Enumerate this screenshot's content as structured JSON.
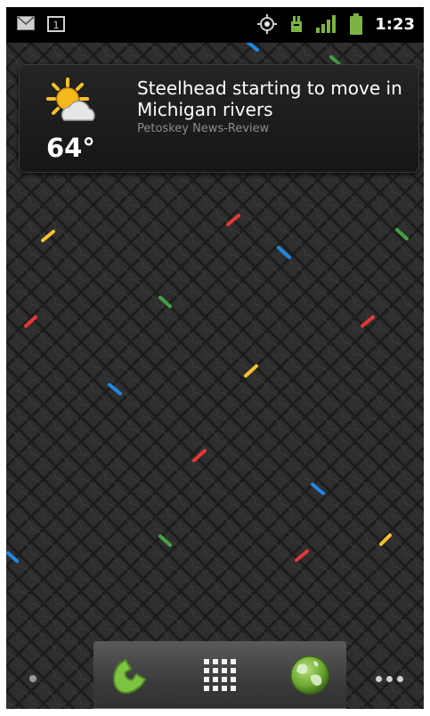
{
  "status_bar": {
    "time": "1:23",
    "left_icons": [
      "gmail-icon",
      "calendar-icon"
    ],
    "right_icons": [
      "gps-icon",
      "usb-debug-icon",
      "signal-icon",
      "battery-icon"
    ],
    "calendar_day": "1"
  },
  "weather_widget": {
    "temperature": "64°",
    "headline": "Steelhead starting to move in Michigan rivers",
    "source": "Petoskey News-Review",
    "weather_icon": "partly-cloudy-icon"
  },
  "dock": {
    "phone_icon": "phone-icon",
    "apps_icon": "app-drawer-icon",
    "browser_icon": "browser-globe-icon"
  },
  "wallpaper": {
    "background": "#2b2b2b",
    "accent_colors": [
      "#e53935",
      "#1e88e5",
      "#fbc02d",
      "#43a047"
    ]
  }
}
